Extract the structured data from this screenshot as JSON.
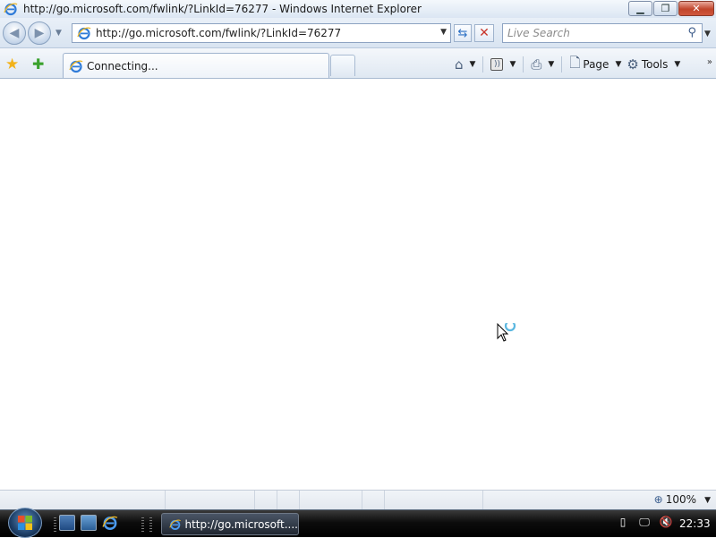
{
  "window": {
    "title": "http://go.microsoft.com/fwlink/?LinkId=76277 - Windows Internet Explorer"
  },
  "address_bar": {
    "url": "http://go.microsoft.com/fwlink/?LinkId=76277"
  },
  "search": {
    "placeholder": "Live Search"
  },
  "tab": {
    "label": "Connecting..."
  },
  "command_bar": {
    "page_label": "Page",
    "tools_label": "Tools"
  },
  "status_bar": {
    "zoom": "100%"
  },
  "taskbar": {
    "task_label": "http://go.microsoft....",
    "clock": "22:33"
  },
  "colors": {
    "ie_blue": "#2f7bd8",
    "close_red": "#c1452b"
  }
}
